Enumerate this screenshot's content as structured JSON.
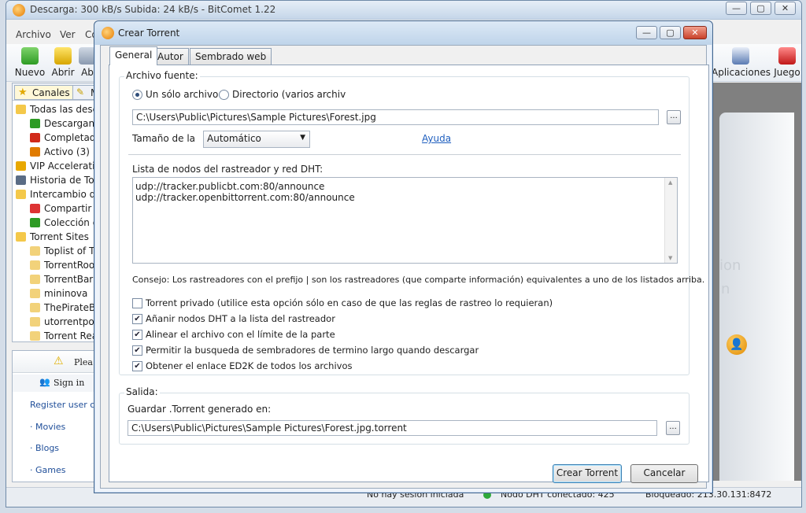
{
  "main_window": {
    "title": "Descarga: 300 kB/s Subida: 24 kB/s - BitComet 1.22",
    "menu": [
      "Archivo",
      "Ver",
      "Co"
    ],
    "toolbar_left": [
      "Nuevo",
      "Abrir",
      "Ab"
    ],
    "toolbar_right": [
      "Aplicaciones",
      "Juego"
    ],
    "sidebar": {
      "tabs": [
        "Canales",
        "M"
      ],
      "items": [
        {
          "label": "Todas las descargas",
          "icon": "folder-icon",
          "indent": 0
        },
        {
          "label": "Descargando",
          "icon": "down-arrow-icon",
          "indent": 1
        },
        {
          "label": "Completado",
          "icon": "checkmark-icon",
          "indent": 1
        },
        {
          "label": "Activo (3)",
          "icon": "updown-arrow-icon",
          "indent": 1
        },
        {
          "label": "VIP Acceleration",
          "icon": "lightning-icon",
          "indent": 0
        },
        {
          "label": "Historia de Torrents",
          "icon": "history-icon",
          "indent": 0
        },
        {
          "label": "Intercambio de",
          "icon": "folder-icon",
          "indent": 0
        },
        {
          "label": "Compartir T",
          "icon": "share-icon",
          "indent": 1
        },
        {
          "label": "Colección d",
          "icon": "collection-icon",
          "indent": 1
        },
        {
          "label": "Torrent Sites",
          "icon": "folder-icon",
          "indent": 0
        },
        {
          "label": "Toplist of T",
          "icon": "site-icon",
          "indent": 1
        },
        {
          "label": "TorrentRoom",
          "icon": "site-icon",
          "indent": 1
        },
        {
          "label": "TorrentBar",
          "icon": "site-icon",
          "indent": 1
        },
        {
          "label": "mininova",
          "icon": "site-icon",
          "indent": 1
        },
        {
          "label": "ThePirateBay",
          "icon": "site-icon",
          "indent": 1
        },
        {
          "label": "utorrentportal",
          "icon": "site-icon",
          "indent": 1
        },
        {
          "label": "Torrent Reactor",
          "icon": "site-icon",
          "indent": 1
        }
      ]
    },
    "ad_panel": {
      "warning": "Plea",
      "signin": "Sign in",
      "register": "Register user ca",
      "links": [
        "· Movies",
        "· Blogs",
        "· Games"
      ]
    },
    "status": {
      "session": "No hay sesión iniciada",
      "dht": "Nodo DHT conectado: 425",
      "blocked": "Bloqueado: 213.30.131:8472"
    },
    "right_panel": {
      "text1": "ion",
      "text2": "n"
    }
  },
  "dialog": {
    "title": "Crear Torrent",
    "tabs": [
      "General",
      "Autor",
      "Sembrado web"
    ],
    "active_tab": "General",
    "source": {
      "group_label": "Archivo fuente:",
      "radio_single": "Un sólo archivo",
      "radio_dir": "Directorio (varios archiv",
      "selected": "single",
      "path": "C:\\Users\\Public\\Pictures\\Sample Pictures\\Forest.jpg",
      "browse": "...",
      "piece_label": "Tamaño de la",
      "piece_value": "Automático",
      "help_link": "Ayuda"
    },
    "trackers": {
      "label": "Lista de nodos del rastreador y red DHT:",
      "lines": [
        "udp://tracker.publicbt.com:80/announce",
        "udp://tracker.openbittorrent.com:80/announce"
      ],
      "tip": "Consejo: Los rastreadores con el prefijo | son los rastreadores (que comparte información) equivalentes a uno de los listados arriba."
    },
    "options": [
      {
        "label": "Torrent privado (utilice esta opción sólo en caso de que las reglas de rastreo lo requieran)",
        "checked": false
      },
      {
        "label": "Añanir nodos DHT a la lista del rastreador",
        "checked": true
      },
      {
        "label": "Alinear el archivo con el límite de la parte",
        "checked": true
      },
      {
        "label": "Permitir la busqueda de sembradores de termino largo quando descargar",
        "checked": true
      },
      {
        "label": "Obtener el enlace ED2K de todos los archivos",
        "checked": true
      }
    ],
    "output": {
      "group_label": "Salida:",
      "save_label": "Guardar .Torrent generado en:",
      "path": "C:\\Users\\Public\\Pictures\\Sample Pictures\\Forest.jpg.torrent",
      "browse": "..."
    },
    "buttons": {
      "create": "Crear Torrent",
      "cancel": "Cancelar"
    }
  },
  "colors": {
    "accent": "#3c7fb1",
    "link": "#1f5fbf",
    "dialog_border": "#44678f"
  }
}
